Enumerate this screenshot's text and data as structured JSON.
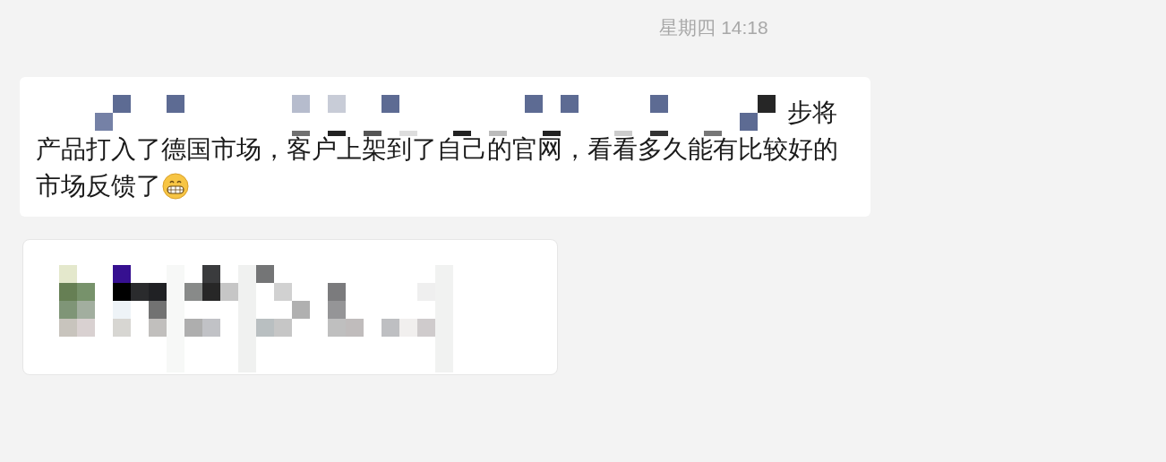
{
  "timestamp": "星期四 14:18",
  "messages": [
    {
      "kind": "text",
      "lines": [
        "步将",
        "产品打入了德国市场，客户上架到了自己的官网，看看多久能有比较好的",
        "市场反馈了"
      ],
      "has_emoji": true
    },
    {
      "kind": "picture"
    }
  ]
}
